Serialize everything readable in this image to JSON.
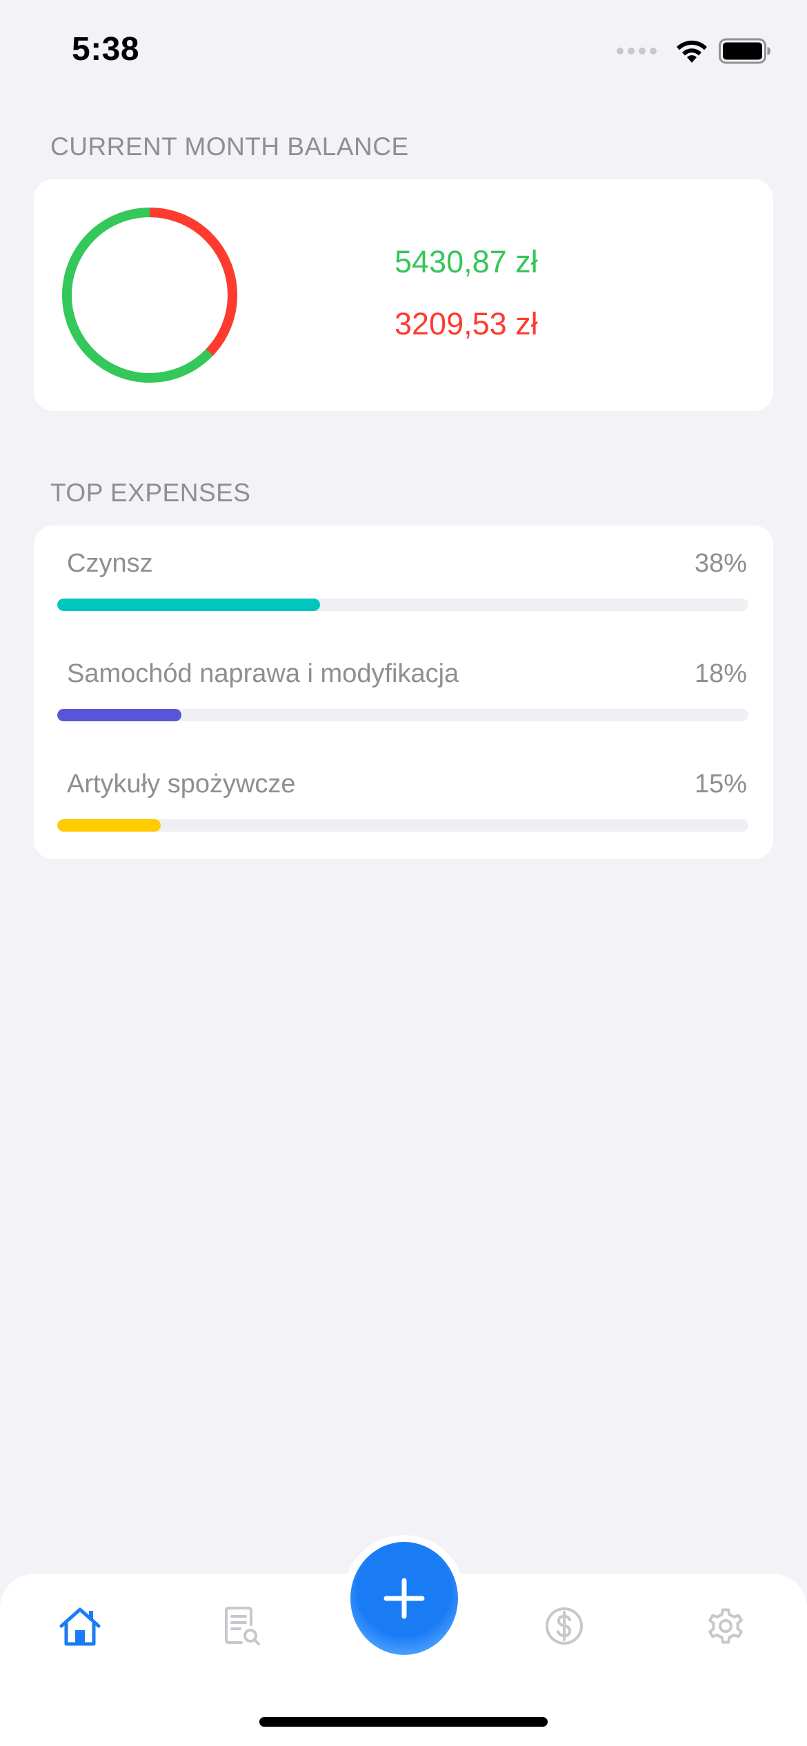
{
  "status_bar": {
    "time": "5:38",
    "icons": [
      "cellular-dots-icon",
      "wifi-icon",
      "battery-icon"
    ]
  },
  "balance": {
    "header": "CURRENT MONTH BALANCE",
    "income": "5430,87 zł",
    "expense": "3209,53 zł",
    "income_color": "#34c759",
    "expense_color": "#ff3b30",
    "expense_fraction": 0.3714
  },
  "top_expenses": {
    "header": "TOP EXPENSES",
    "items": [
      {
        "name": "Czynsz",
        "percent_label": "38%",
        "percent": 38,
        "color": "#00c7be"
      },
      {
        "name": "Samochód naprawa i modyfikacja",
        "percent_label": "18%",
        "percent": 18,
        "color": "#5856d6"
      },
      {
        "name": "Artykuły spożywcze",
        "percent_label": "15%",
        "percent": 15,
        "color": "#ffcc00"
      }
    ]
  },
  "tab_bar": {
    "items": [
      {
        "id": "home",
        "icon": "home-icon",
        "active": true
      },
      {
        "id": "transactions",
        "icon": "document-search-icon",
        "active": false
      },
      {
        "id": "add",
        "icon": "plus-icon",
        "active": false
      },
      {
        "id": "budget",
        "icon": "dollar-circle-icon",
        "active": false
      },
      {
        "id": "settings",
        "icon": "gear-icon",
        "active": false
      }
    ],
    "accent_color": "#1a7cf5",
    "inactive_color": "#c7c7cc"
  }
}
